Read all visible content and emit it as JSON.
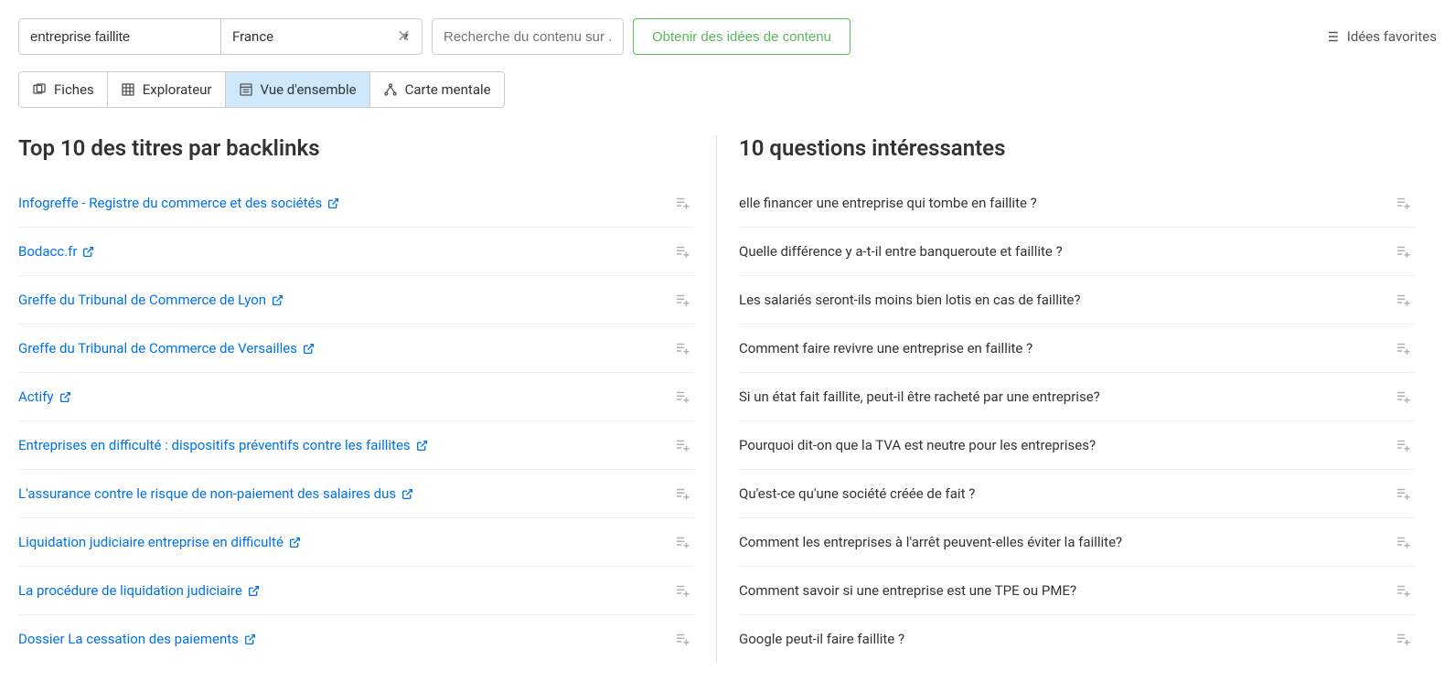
{
  "header": {
    "keyword_value": "entreprise faillite",
    "country_value": "France",
    "search_placeholder": "Recherche du contenu sur ...",
    "get_ideas_label": "Obtenir des idées de contenu",
    "fav_ideas_label": "Idées favorites"
  },
  "tabs": {
    "fiches": "Fiches",
    "explorateur": "Explorateur",
    "vue": "Vue d'ensemble",
    "carte": "Carte mentale"
  },
  "left_column": {
    "title": "Top 10 des titres par backlinks",
    "items": [
      "Infogreffe - Registre du commerce et des sociétés",
      "Bodacc.fr",
      "Greffe du Tribunal de Commerce de Lyon",
      "Greffe du Tribunal de Commerce de Versailles",
      "Actify",
      "Entreprises en difficulté : dispositifs préventifs contre les faillites",
      "L'assurance contre le risque de non-paiement des salaires dus",
      "Liquidation judiciaire entreprise en difficulté",
      "La procédure de liquidation judiciaire",
      "Dossier La cessation des paiements"
    ]
  },
  "right_column": {
    "title": "10 questions intéressantes",
    "items": [
      "elle financer une entreprise qui tombe en faillite ?",
      "Quelle différence y a-t-il entre banqueroute et faillite ?",
      "Les salariés seront-ils moins bien lotis en cas de faillite?",
      "Comment faire revivre une entreprise en faillite ?",
      "Si un état fait faillite, peut-il être racheté par une entreprise?",
      "Pourquoi dit-on que la TVA est neutre pour les entreprises?",
      "Qu'est-ce qu'une société créée de fait ?",
      "Comment les entreprises à l'arrêt peuvent-elles éviter la faillite?",
      "Comment savoir si une entreprise est une TPE ou PME?",
      "Google peut-il faire faillite ?"
    ]
  }
}
